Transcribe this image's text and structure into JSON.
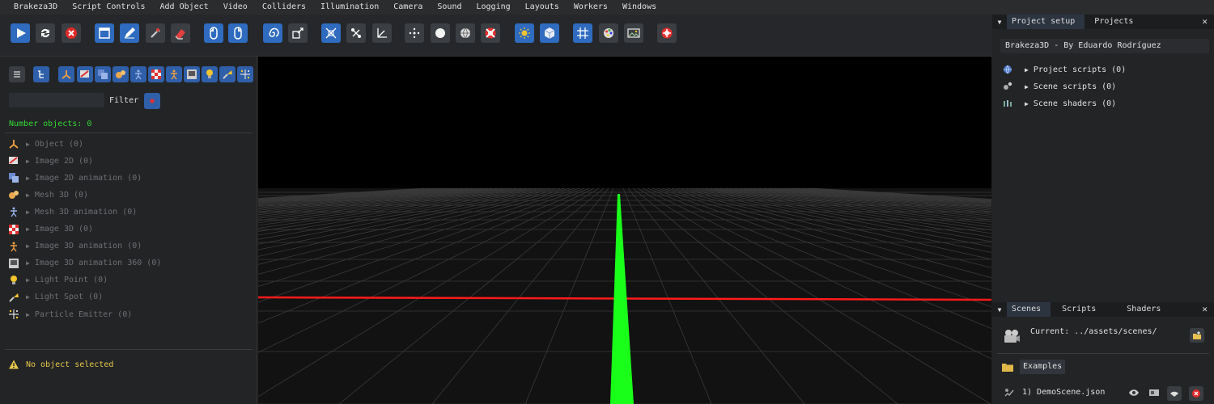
{
  "menu": [
    "Brakeza3D",
    "Script Controls",
    "Add Object",
    "Video",
    "Colliders",
    "Illumination",
    "Camera",
    "Sound",
    "Logging",
    "Layouts",
    "Workers",
    "Windows"
  ],
  "colors": {
    "accent_blue": "#2f6bbf",
    "count_green": "#36d736",
    "warning_yellow": "#e8c84a",
    "axis_red": "#ff1a1a",
    "axis_green": "#1aff1a",
    "stop_red": "#e02828"
  },
  "toolbar": {
    "icons": [
      "play-icon",
      "reload-icon",
      "stop-icon",
      "window-icon",
      "edit-icon",
      "wrench-icon",
      "eraser-icon",
      "mouse-left-icon",
      "mouse-right-icon",
      "spiral-icon",
      "transform-icon",
      "fit-icon",
      "connect-icon",
      "axes-icon",
      "dots-icon",
      "sphere-icon",
      "globe-icon",
      "lifebuoy-icon",
      "sun-icon",
      "cube-icon",
      "grid-icon",
      "palette-icon",
      "image-icon",
      "help-icon"
    ]
  },
  "left_panel": {
    "filter_label": "Filter",
    "filter_value": "",
    "count_label": "Number objects: 0",
    "objects": [
      {
        "label": "Object (0)",
        "icon": "axis-icon"
      },
      {
        "label": "Image 2D (0)",
        "icon": "image2d-icon"
      },
      {
        "label": "Image 2D animation (0)",
        "icon": "image2d-animation-icon"
      },
      {
        "label": "Mesh 3D (0)",
        "icon": "mesh3d-icon"
      },
      {
        "label": "Mesh 3D animation (0)",
        "icon": "mesh3d-animation-icon"
      },
      {
        "label": "Image 3D (0)",
        "icon": "image3d-icon"
      },
      {
        "label": "Image 3D animation (0)",
        "icon": "image3d-animation-icon"
      },
      {
        "label": "Image 3D animation 360 (0)",
        "icon": "image3d-360-icon"
      },
      {
        "label": "Light Point (0)",
        "icon": "light-point-icon"
      },
      {
        "label": "Light Spot (0)",
        "icon": "light-spot-icon"
      },
      {
        "label": "Particle Emitter (0)",
        "icon": "particle-emitter-icon"
      }
    ],
    "status": "No object selected"
  },
  "right_panel": {
    "top_tabs": [
      "Project setup",
      "Projects"
    ],
    "project_title": "Brakeza3D - By Eduardo Rodríguez",
    "project_items": [
      "Project scripts (0)",
      "Scene scripts (0)",
      "Scene shaders (0)"
    ],
    "bottom_tabs": [
      "Scenes",
      "Scripts",
      "Shaders"
    ],
    "current_path": "Current: ../assets/scenes/",
    "examples_label": "Examples",
    "scene_file": "1) DemoScene.json"
  }
}
